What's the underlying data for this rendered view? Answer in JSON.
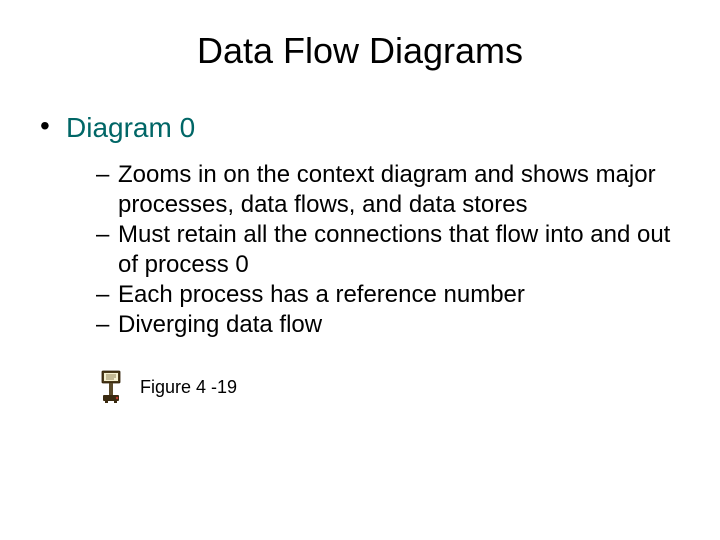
{
  "title": "Data Flow Diagrams",
  "bullet_lvl1": "Diagram 0",
  "sub_bullets": {
    "b1": "Zooms in on the context diagram and shows major processes, data flows, and data stores",
    "b2": "Must retain all the connections that flow into and out of process 0",
    "b3": "Each process has a reference number",
    "b4": "Diverging data flow"
  },
  "figure_caption": "Figure 4 -19"
}
